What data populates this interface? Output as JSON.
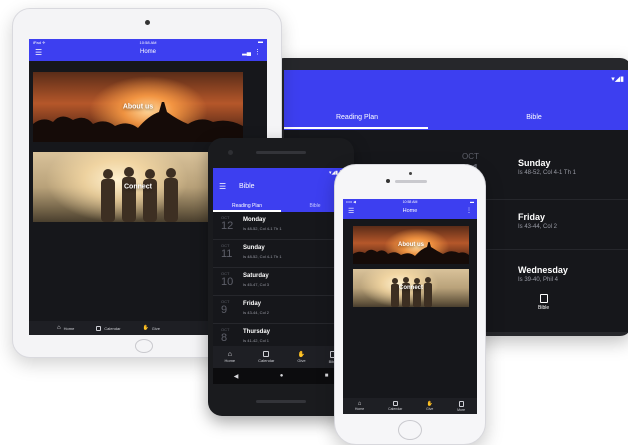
{
  "tablet_portrait": {
    "status": {
      "left": "iPad ✈",
      "center": "10:58 AM",
      "right": "▬"
    },
    "title": "Home",
    "cards": [
      {
        "label": "About us"
      },
      {
        "label": "Connect"
      }
    ],
    "nav": [
      {
        "label": "Home",
        "icon": "home-icon"
      },
      {
        "label": "Calendar",
        "icon": "calendar-icon"
      },
      {
        "label": "Give",
        "icon": "give-icon"
      }
    ]
  },
  "tablet_landscape": {
    "tabs": [
      {
        "label": "Reading Plan"
      },
      {
        "label": "Bible"
      }
    ],
    "rows": [
      {
        "month": "OCT",
        "day": "11",
        "title": "Sunday",
        "ref": "Is 48-52, Col 4-1 Th 1"
      },
      {
        "month": "",
        "day": "",
        "title": "Friday",
        "ref": "Is 43-44, Col 2"
      },
      {
        "month": "",
        "day": "",
        "title": "Wednesday",
        "ref": "Is 39-40, Phil 4"
      }
    ],
    "nav": [
      {
        "label": "Bible",
        "icon": "book-icon"
      }
    ]
  },
  "android_phone": {
    "title": "Bible",
    "tabs": [
      {
        "label": "Reading Plan"
      },
      {
        "label": "Bible"
      }
    ],
    "rows": [
      {
        "month": "OCT",
        "day": "12",
        "title": "Monday",
        "ref": "Is 48-52, Col 4-1 Th 1"
      },
      {
        "month": "OCT",
        "day": "11",
        "title": "Sunday",
        "ref": "Is 48-52, Col 4-1 Th 1"
      },
      {
        "month": "OCT",
        "day": "10",
        "title": "Saturday",
        "ref": "Is 45-47, Col 3"
      },
      {
        "month": "OCT",
        "day": "9",
        "title": "Friday",
        "ref": "Is 43-44, Col 2"
      },
      {
        "month": "OCT",
        "day": "8",
        "title": "Thursday",
        "ref": "Is 41-42, Col 1"
      }
    ],
    "nav": [
      {
        "label": "Home",
        "icon": "home-icon"
      },
      {
        "label": "Calendar",
        "icon": "calendar-icon"
      },
      {
        "label": "Give",
        "icon": "give-icon"
      },
      {
        "label": "Bible",
        "icon": "book-icon"
      }
    ]
  },
  "iphone": {
    "status": {
      "left": "••••• ◀",
      "center": "10:58 AM",
      "right": "▬"
    },
    "title": "Home",
    "cards": [
      {
        "label": "About us"
      },
      {
        "label": "Connect"
      }
    ],
    "nav": [
      {
        "label": "Home",
        "icon": "home-icon"
      },
      {
        "label": "Calendar",
        "icon": "calendar-icon"
      },
      {
        "label": "Give",
        "icon": "give-icon"
      },
      {
        "label": "More",
        "icon": "more-icon"
      }
    ]
  },
  "colors": {
    "accent": "#3d3ff0",
    "background": "#16171b",
    "nav": "#1e1f24"
  }
}
